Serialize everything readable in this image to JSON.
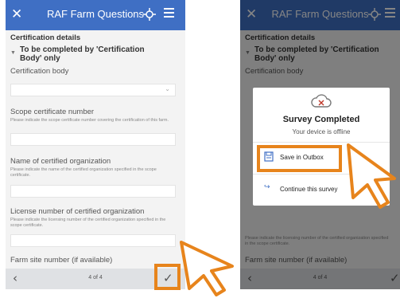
{
  "app": {
    "title": "RAF Farm Questions",
    "section": "Certification details",
    "group": "To be completed by 'Certification Body' only"
  },
  "questions": [
    {
      "label": "Certification body",
      "hint": ""
    },
    {
      "label": "Scope certificate number",
      "hint": "Please indicate the scope certificate number covering the certification of this farm."
    },
    {
      "label": "Name of certified organization",
      "hint": "Please indicate the name of the certified organization specified in the scope certificate."
    },
    {
      "label": "License number of certified organization",
      "hint": "Please indicate the licensing number of the certified organization specified in the scope certificate."
    },
    {
      "label": "Farm site number (if available)",
      "hint": ""
    }
  ],
  "nav": {
    "page": "4 of 4"
  },
  "dialog": {
    "title": "Survey Completed",
    "message": "Your device is offline",
    "save_label": "Save in Outbox",
    "continue_label": "Continue this survey"
  },
  "right_bg": {
    "hint_partial": "Please indicate the licensing number of the certified organization specified in the scope certificate."
  },
  "colors": {
    "header": "#3f6fc4",
    "highlight": "#e7841c"
  },
  "icons": [
    "close-icon",
    "gps-icon",
    "menu-icon",
    "chevron-down-icon",
    "back-arrow-icon",
    "checkmark-icon",
    "cloud-offline-icon",
    "save-outbox-icon",
    "continue-arrow-icon",
    "pointer-cursor-icon"
  ]
}
